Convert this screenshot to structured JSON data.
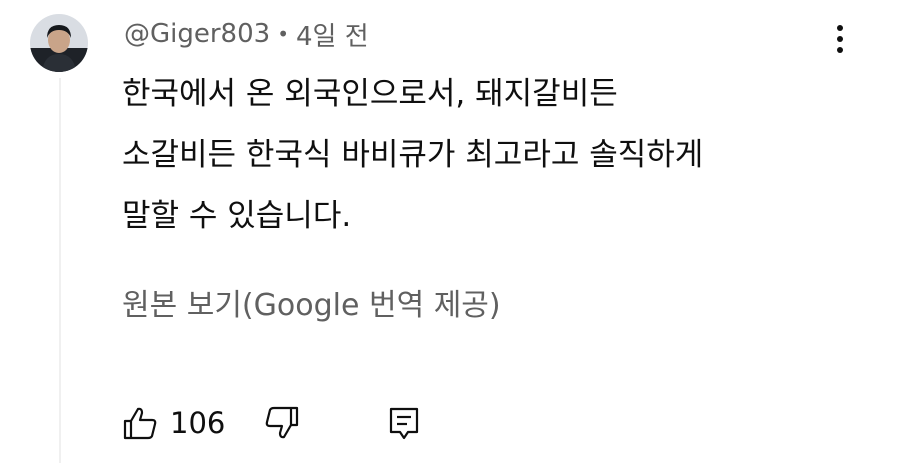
{
  "comment": {
    "author": "@Giger803",
    "separator": "•",
    "time_ago": "4일 전",
    "text_lines": [
      "한국에서 온 외국인으로서, 돼지갈비든",
      "소갈비든 한국식 바비큐가 최고라고 솔직하게",
      "말할 수 있습니다."
    ],
    "see_original": "원본 보기(Google 번역 제공)",
    "like_count": "106"
  },
  "icons": {
    "avatar": "user-avatar",
    "menu": "more-vertical-icon",
    "like": "thumbs-up-icon",
    "dislike": "thumbs-down-icon",
    "reply": "comment-reply-icon"
  },
  "colors": {
    "primary_text": "#0f0f0f",
    "secondary_text": "#606060",
    "thread_line": "#f0f0f0"
  }
}
